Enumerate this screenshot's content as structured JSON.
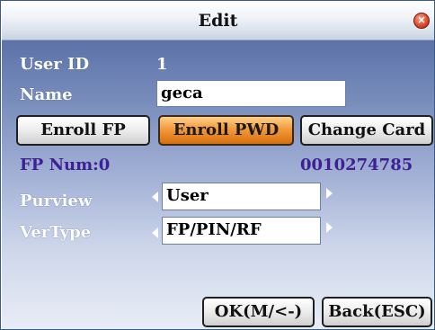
{
  "window": {
    "title": "Edit",
    "close_icon": "close-icon"
  },
  "form": {
    "user_id_label": "User ID",
    "user_id_value": "1",
    "name_label": "Name",
    "name_value": "geca",
    "purview_label": "Purview",
    "purview_value": "User",
    "vertype_label": "VerType",
    "vertype_value": "FP/PIN/RF"
  },
  "buttons": {
    "enroll_fp": "Enroll FP",
    "enroll_pwd": "Enroll PWD",
    "change_card": "Change Card",
    "ok": "OK(M/<-)",
    "back": "Back(ESC)"
  },
  "info": {
    "fp_num": "FP Num:0",
    "card_number": "0010274785"
  },
  "colors": {
    "accent_orange": "#f39a3a",
    "info_purple": "#3f1f94",
    "panel_blue": "#5c72a8"
  }
}
